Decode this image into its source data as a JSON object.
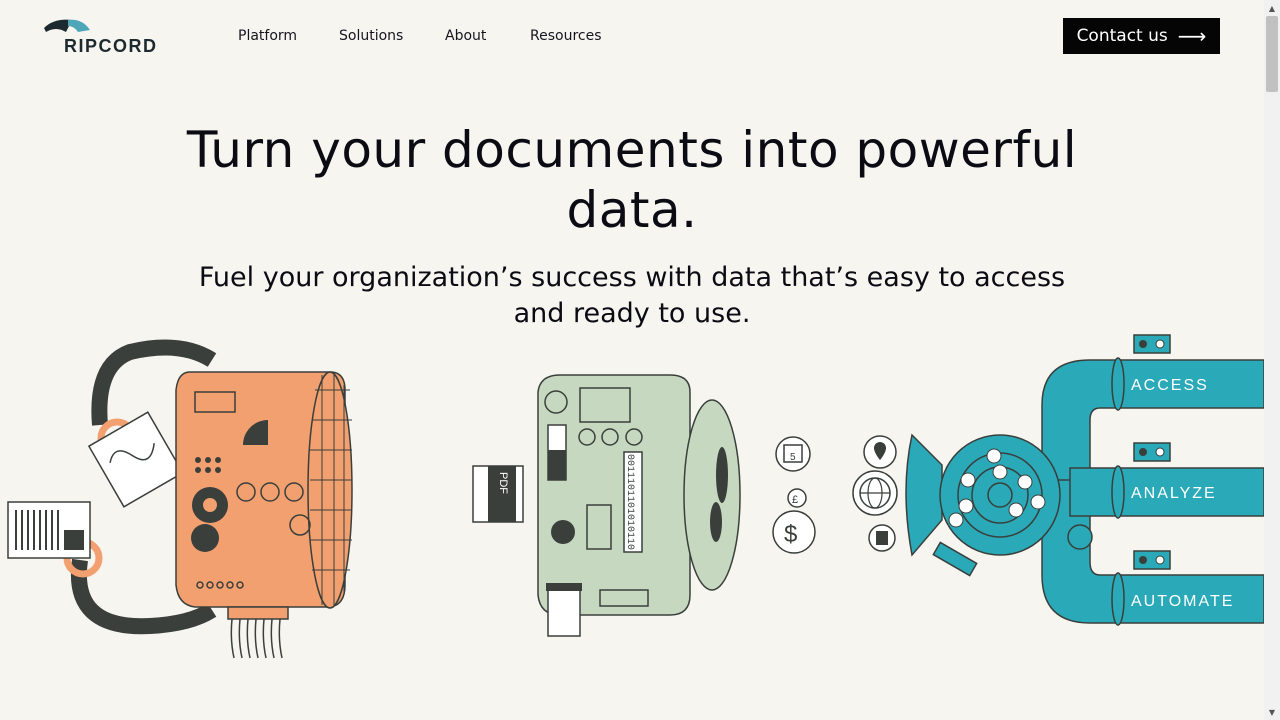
{
  "brand": {
    "name": "RIPCORD"
  },
  "nav": {
    "items": [
      {
        "label": "Platform"
      },
      {
        "label": "Solutions"
      },
      {
        "label": "About"
      },
      {
        "label": "Resources"
      }
    ]
  },
  "cta": {
    "label": "Contact us",
    "icon": "arrow-right-icon"
  },
  "hero": {
    "title": "Turn your documents into powerful data.",
    "subtitle": "Fuel your organization’s success with data that’s easy to access and ready to use."
  },
  "illustration": {
    "machine_label": "PDF",
    "binary_text": "0011101101010110",
    "calendar_day": "5",
    "pipes": [
      {
        "label": "ACCESS"
      },
      {
        "label": "ANALYZE"
      },
      {
        "label": "AUTOMATE"
      }
    ],
    "colors": {
      "orange": "#f2a070",
      "sage": "#c6d8c0",
      "teal": "#2aa9b8",
      "dark": "#3a3f3b"
    }
  }
}
